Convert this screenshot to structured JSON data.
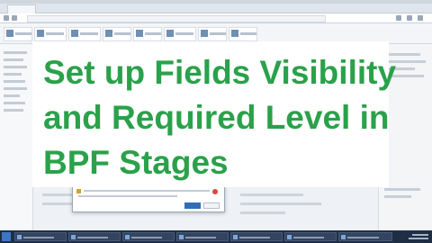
{
  "overlay": {
    "lines": [
      "Set up Fields Visibility",
      "and Required Level in",
      "BPF Stages"
    ],
    "text_color": "#2aa14a"
  },
  "colors": {
    "accent": "#2f6fb7",
    "taskbar": "#1f2e45"
  },
  "icons": {
    "dialog_error": "error-icon",
    "dialog_warning": "warning-icon",
    "start": "windows-start-icon"
  }
}
